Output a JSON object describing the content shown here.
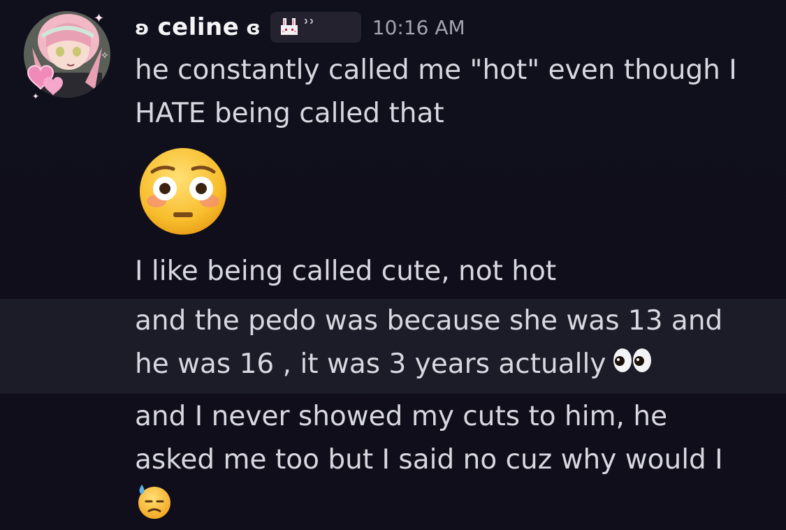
{
  "message_group": {
    "author": {
      "deco_left": "ʚ",
      "name": "celine",
      "deco_right": "ɞ",
      "tag_text": "ʾʾ"
    },
    "timestamp": "10:16 AM",
    "messages": [
      {
        "line1": "he constantly called me \"hot\" even though I",
        "line2": "HATE being called that"
      },
      {
        "emoji": "flushed-face"
      },
      {
        "line1": "I like being called cute, not hot"
      },
      {
        "line1": "and the pedo was because she was 13 and",
        "line2": "he was 16 , it was 3 years actually",
        "trailing_emoji": "eyes"
      },
      {
        "line1": "and I never showed my cuts to him, he",
        "line2": "asked me too but I said no cuz why would I",
        "trailing_emoji": "downcast-face-with-sweat"
      }
    ]
  },
  "colors": {
    "background": "#0f0e1a",
    "hover_row": "#1c1b28",
    "text": "#d8d8e0",
    "username": "#f5f5f8",
    "timestamp": "#a4a4b0"
  }
}
